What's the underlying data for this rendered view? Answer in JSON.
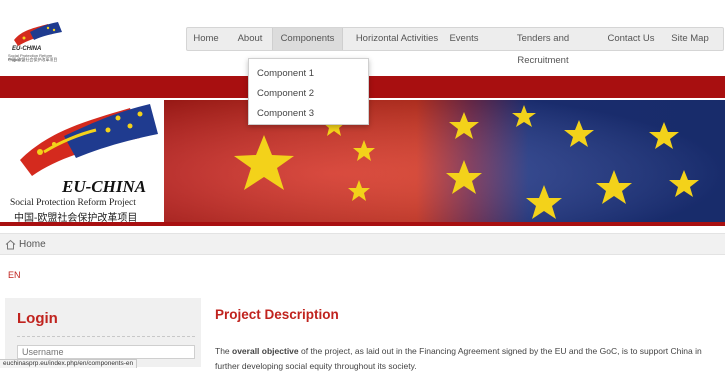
{
  "header": {
    "logo_title": "EU-CHINA",
    "logo_sub_en": "Social Protection Reform Project",
    "logo_sub_cn": "中国-欧盟社会保护改革项目"
  },
  "nav": {
    "items": [
      "Home",
      "About",
      "Components",
      "Horizontal Activities",
      "Events",
      "Tenders and Recruitment",
      "Contact Us",
      "Site Map"
    ],
    "active": "Components"
  },
  "dropdown": {
    "items": [
      "Component 1",
      "Component 2",
      "Component 3"
    ]
  },
  "banner": {
    "title": "EU-CHINA",
    "subtitle_en": "Social Protection Reform Project",
    "subtitle_cn": "中国-欧盟社会保护改革项目"
  },
  "breadcrumb": {
    "home": "Home"
  },
  "lang": "EN",
  "sidebar": {
    "login_title": "Login",
    "username_placeholder": "Username"
  },
  "main": {
    "title": "Project Description",
    "line1_pre": "The ",
    "line1_bold": "overall objective",
    "line1_post": " of the project, as laid out in the Financing Agreement signed by the EU and the GoC, is to support China in",
    "line2": "further developing social equity throughout its society."
  },
  "statusbar": {
    "url": "euchinasprp.eu/index.php/en/components-en"
  },
  "colors": {
    "brand_red": "#a80f10",
    "title_red": "#c0231e",
    "eu_blue": "#1f3b8f",
    "cn_red": "#d42a1e",
    "star_yellow": "#f3d21a"
  }
}
